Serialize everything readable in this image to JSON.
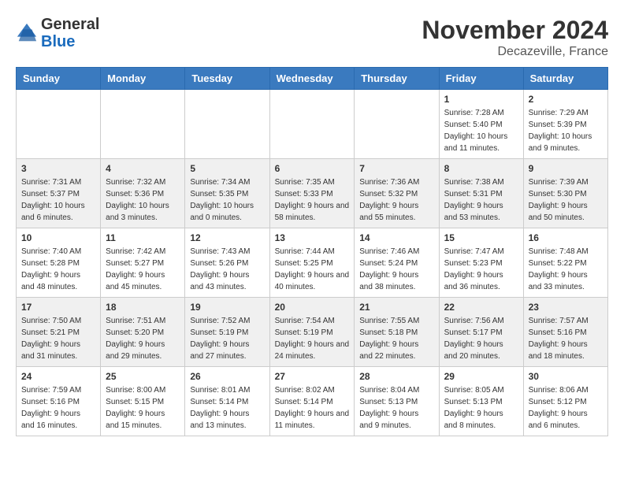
{
  "header": {
    "logo": {
      "general": "General",
      "blue": "Blue"
    },
    "title": "November 2024",
    "location": "Decazeville, France"
  },
  "days_of_week": [
    "Sunday",
    "Monday",
    "Tuesday",
    "Wednesday",
    "Thursday",
    "Friday",
    "Saturday"
  ],
  "weeks": [
    [
      {
        "day": "",
        "info": ""
      },
      {
        "day": "",
        "info": ""
      },
      {
        "day": "",
        "info": ""
      },
      {
        "day": "",
        "info": ""
      },
      {
        "day": "",
        "info": ""
      },
      {
        "day": "1",
        "info": "Sunrise: 7:28 AM\nSunset: 5:40 PM\nDaylight: 10 hours and 11 minutes."
      },
      {
        "day": "2",
        "info": "Sunrise: 7:29 AM\nSunset: 5:39 PM\nDaylight: 10 hours and 9 minutes."
      }
    ],
    [
      {
        "day": "3",
        "info": "Sunrise: 7:31 AM\nSunset: 5:37 PM\nDaylight: 10 hours and 6 minutes."
      },
      {
        "day": "4",
        "info": "Sunrise: 7:32 AM\nSunset: 5:36 PM\nDaylight: 10 hours and 3 minutes."
      },
      {
        "day": "5",
        "info": "Sunrise: 7:34 AM\nSunset: 5:35 PM\nDaylight: 10 hours and 0 minutes."
      },
      {
        "day": "6",
        "info": "Sunrise: 7:35 AM\nSunset: 5:33 PM\nDaylight: 9 hours and 58 minutes."
      },
      {
        "day": "7",
        "info": "Sunrise: 7:36 AM\nSunset: 5:32 PM\nDaylight: 9 hours and 55 minutes."
      },
      {
        "day": "8",
        "info": "Sunrise: 7:38 AM\nSunset: 5:31 PM\nDaylight: 9 hours and 53 minutes."
      },
      {
        "day": "9",
        "info": "Sunrise: 7:39 AM\nSunset: 5:30 PM\nDaylight: 9 hours and 50 minutes."
      }
    ],
    [
      {
        "day": "10",
        "info": "Sunrise: 7:40 AM\nSunset: 5:28 PM\nDaylight: 9 hours and 48 minutes."
      },
      {
        "day": "11",
        "info": "Sunrise: 7:42 AM\nSunset: 5:27 PM\nDaylight: 9 hours and 45 minutes."
      },
      {
        "day": "12",
        "info": "Sunrise: 7:43 AM\nSunset: 5:26 PM\nDaylight: 9 hours and 43 minutes."
      },
      {
        "day": "13",
        "info": "Sunrise: 7:44 AM\nSunset: 5:25 PM\nDaylight: 9 hours and 40 minutes."
      },
      {
        "day": "14",
        "info": "Sunrise: 7:46 AM\nSunset: 5:24 PM\nDaylight: 9 hours and 38 minutes."
      },
      {
        "day": "15",
        "info": "Sunrise: 7:47 AM\nSunset: 5:23 PM\nDaylight: 9 hours and 36 minutes."
      },
      {
        "day": "16",
        "info": "Sunrise: 7:48 AM\nSunset: 5:22 PM\nDaylight: 9 hours and 33 minutes."
      }
    ],
    [
      {
        "day": "17",
        "info": "Sunrise: 7:50 AM\nSunset: 5:21 PM\nDaylight: 9 hours and 31 minutes."
      },
      {
        "day": "18",
        "info": "Sunrise: 7:51 AM\nSunset: 5:20 PM\nDaylight: 9 hours and 29 minutes."
      },
      {
        "day": "19",
        "info": "Sunrise: 7:52 AM\nSunset: 5:19 PM\nDaylight: 9 hours and 27 minutes."
      },
      {
        "day": "20",
        "info": "Sunrise: 7:54 AM\nSunset: 5:19 PM\nDaylight: 9 hours and 24 minutes."
      },
      {
        "day": "21",
        "info": "Sunrise: 7:55 AM\nSunset: 5:18 PM\nDaylight: 9 hours and 22 minutes."
      },
      {
        "day": "22",
        "info": "Sunrise: 7:56 AM\nSunset: 5:17 PM\nDaylight: 9 hours and 20 minutes."
      },
      {
        "day": "23",
        "info": "Sunrise: 7:57 AM\nSunset: 5:16 PM\nDaylight: 9 hours and 18 minutes."
      }
    ],
    [
      {
        "day": "24",
        "info": "Sunrise: 7:59 AM\nSunset: 5:16 PM\nDaylight: 9 hours and 16 minutes."
      },
      {
        "day": "25",
        "info": "Sunrise: 8:00 AM\nSunset: 5:15 PM\nDaylight: 9 hours and 15 minutes."
      },
      {
        "day": "26",
        "info": "Sunrise: 8:01 AM\nSunset: 5:14 PM\nDaylight: 9 hours and 13 minutes."
      },
      {
        "day": "27",
        "info": "Sunrise: 8:02 AM\nSunset: 5:14 PM\nDaylight: 9 hours and 11 minutes."
      },
      {
        "day": "28",
        "info": "Sunrise: 8:04 AM\nSunset: 5:13 PM\nDaylight: 9 hours and 9 minutes."
      },
      {
        "day": "29",
        "info": "Sunrise: 8:05 AM\nSunset: 5:13 PM\nDaylight: 9 hours and 8 minutes."
      },
      {
        "day": "30",
        "info": "Sunrise: 8:06 AM\nSunset: 5:12 PM\nDaylight: 9 hours and 6 minutes."
      }
    ]
  ]
}
